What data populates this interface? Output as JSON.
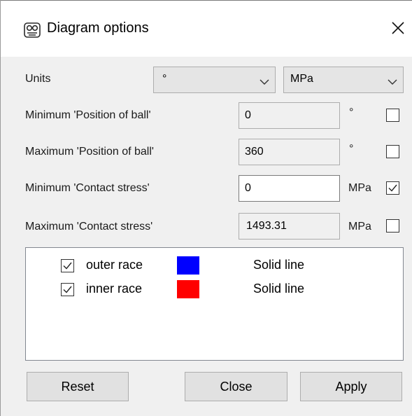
{
  "window": {
    "title": "Diagram options",
    "icon": "app-logo-icon",
    "close_icon": "close-icon"
  },
  "units": {
    "label": "Units",
    "angle_unit": "°",
    "stress_unit": "MPa"
  },
  "limits": [
    {
      "label": "Minimum 'Position of ball'",
      "value": "0",
      "unit": "°",
      "editable": false,
      "checked": false
    },
    {
      "label": "Maximum 'Position of ball'",
      "value": "360",
      "unit": "°",
      "editable": false,
      "checked": false
    },
    {
      "label": "Minimum 'Contact stress'",
      "value": "0",
      "unit": "MPa",
      "editable": true,
      "checked": true
    },
    {
      "label": "Maximum 'Contact stress'",
      "value": "1493.31",
      "unit": "MPa",
      "editable": false,
      "checked": false
    }
  ],
  "series": [
    {
      "name": "outer race",
      "checked": true,
      "color": "#0000ff",
      "line_style": "Solid line"
    },
    {
      "name": "inner race",
      "checked": true,
      "color": "#ff0000",
      "line_style": "Solid line"
    }
  ],
  "buttons": {
    "reset": "Reset",
    "close": "Close",
    "apply": "Apply"
  }
}
